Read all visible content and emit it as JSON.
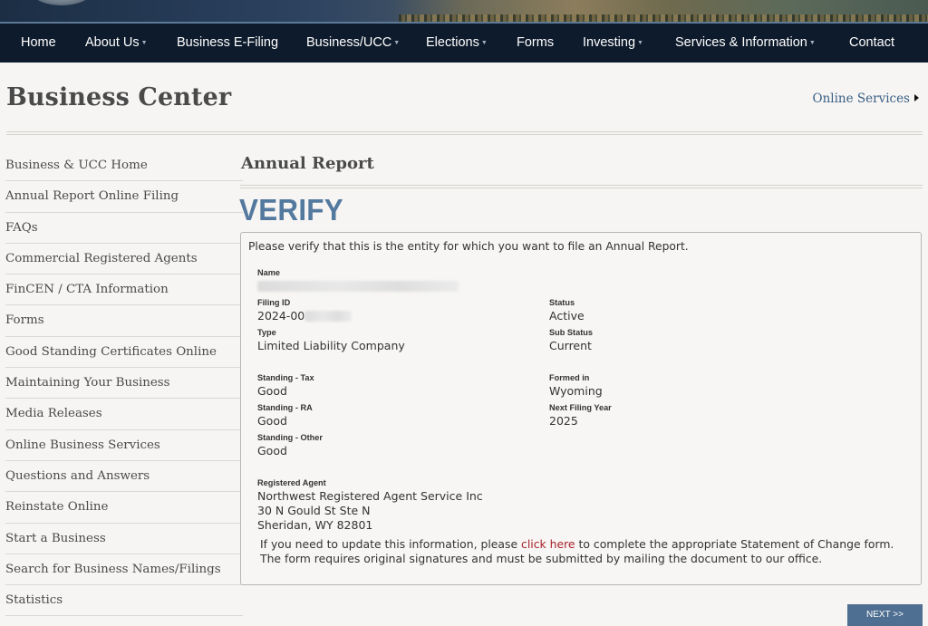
{
  "nav": {
    "items": [
      {
        "label": "Home",
        "dropdown": false
      },
      {
        "label": "About Us",
        "dropdown": true
      },
      {
        "label": "Business E-Filing",
        "dropdown": false
      },
      {
        "label": "Business/UCC",
        "dropdown": true
      },
      {
        "label": "Elections",
        "dropdown": true
      },
      {
        "label": "Forms",
        "dropdown": false
      },
      {
        "label": "Investing",
        "dropdown": true
      },
      {
        "label": "Services & Information",
        "dropdown": true
      },
      {
        "label": "Contact",
        "dropdown": false
      }
    ]
  },
  "page": {
    "title": "Business Center",
    "online_services": "Online Services"
  },
  "sidebar": {
    "items": [
      {
        "label": "Business & UCC Home"
      },
      {
        "label": "Annual Report Online Filing"
      },
      {
        "label": "FAQs"
      },
      {
        "label": "Commercial Registered Agents"
      },
      {
        "label": "FinCEN / CTA Information"
      },
      {
        "label": "Forms"
      },
      {
        "label": "Good Standing Certificates Online"
      },
      {
        "label": "Maintaining Your Business"
      },
      {
        "label": "Media Releases"
      },
      {
        "label": "Online Business Services"
      },
      {
        "label": "Questions and Answers"
      },
      {
        "label": "Reinstate Online"
      },
      {
        "label": "Start a Business"
      },
      {
        "label": "Search for Business Names/Filings"
      },
      {
        "label": "Statistics"
      }
    ]
  },
  "main": {
    "section_title": "Annual Report",
    "verify_heading": "VERIFY",
    "intro": "Please verify that this is the entity for which you want to file an Annual Report.",
    "fields": {
      "name_label": "Name",
      "filing_id_label": "Filing ID",
      "filing_id_value": "2024-00",
      "status_label": "Status",
      "status_value": "Active",
      "type_label": "Type",
      "type_value": "Limited Liability Company",
      "sub_status_label": "Sub Status",
      "sub_status_value": "Current",
      "standing_tax_label": "Standing - Tax",
      "standing_tax_value": "Good",
      "formed_in_label": "Formed in",
      "formed_in_value": "Wyoming",
      "standing_ra_label": "Standing - RA",
      "standing_ra_value": "Good",
      "next_filing_year_label": "Next Filing Year",
      "next_filing_year_value": "2025",
      "standing_other_label": "Standing - Other",
      "standing_other_value": "Good",
      "registered_agent_label": "Registered Agent",
      "registered_agent_name": "Northwest Registered Agent Service Inc",
      "registered_agent_address1": "30 N Gould St Ste N",
      "registered_agent_address2": "Sheridan, WY 82801"
    },
    "update_note": {
      "before_link": "If you need to update this information, please ",
      "link_text": "click here",
      "after_link": " to complete the appropriate Statement of Change form.",
      "line2": "The form requires original signatures and must be submitted by mailing the document to our office."
    },
    "next_button": "NEXT >>"
  },
  "colors": {
    "nav_bg": "#0e1b2c",
    "verify_heading": "#54799e",
    "link_red": "#a8222b",
    "button_bg": "#4f6f92"
  }
}
